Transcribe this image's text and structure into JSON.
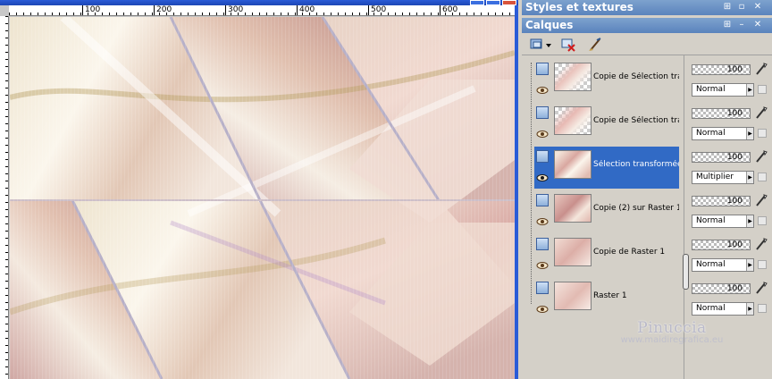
{
  "panels": {
    "styles_title": "Styles et textures",
    "layers_title": "Calques"
  },
  "ruler": {
    "top_labels": [
      "100",
      "200",
      "300",
      "400",
      "500",
      "600"
    ]
  },
  "layers": [
    {
      "name": "Copie de Sélection tran",
      "opacity": "100",
      "blend": "Normal",
      "selected": false
    },
    {
      "name": "Copie de Sélection tran",
      "opacity": "100",
      "blend": "Normal",
      "selected": false
    },
    {
      "name": "Sélection transformée",
      "opacity": "100",
      "blend": "Multiplier",
      "selected": true
    },
    {
      "name": "Copie (2) sur Raster 1",
      "opacity": "100",
      "blend": "Normal",
      "selected": false
    },
    {
      "name": "Copie de Raster 1",
      "opacity": "100",
      "blend": "Normal",
      "selected": false
    },
    {
      "name": "Raster 1",
      "opacity": "100",
      "blend": "Normal",
      "selected": false
    }
  ],
  "watermark": {
    "name": "Pinuccia",
    "url": "www.maidiregrafica.eu"
  },
  "colors": {
    "selection": "#316ac5",
    "panel_title": "#6a8fc4",
    "titlebar": "#2a5bd7"
  }
}
